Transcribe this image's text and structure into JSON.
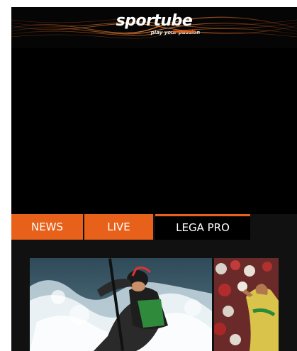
{
  "header": {
    "logo_text": "sportube",
    "tagline": "play your passion",
    "accent_color": "#e8611a"
  },
  "tabs": [
    {
      "label": "NEWS",
      "state": "inactive"
    },
    {
      "label": "LIVE",
      "state": "inactive"
    },
    {
      "label": "LEGA PRO",
      "state": "active"
    }
  ],
  "thumbnails": [
    {
      "subject": "canoe-slalom-athlete"
    },
    {
      "subject": "football-player"
    }
  ],
  "colors": {
    "tab_orange": "#e8611a",
    "active_tab": "#000000",
    "background": "#111111"
  }
}
